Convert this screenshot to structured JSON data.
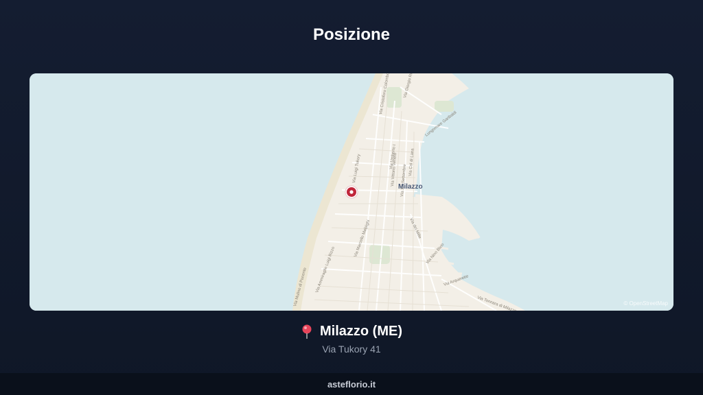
{
  "page": {
    "title": "Posizione"
  },
  "map": {
    "city_label": "Milazzo",
    "attribution": "© OpenStreetMap",
    "street_labels": [
      "Via Luigi Tukory",
      "Via Umberto I",
      "Via Marcello Malpighi",
      "Via dei Mille",
      "Via Nino Bixio",
      "Via Arquerette",
      "Via Tonnara di Milazzo",
      "Lungomare Garibaldi",
      "Via Ammiraglio Luigi Rizzo",
      "Via Mulino di Ponente",
      "Via Cristoforo Colombo",
      "Via Vittorio Veneto",
      "Via Col di Lana",
      "Via XX Settembre",
      "Via Giorgio Rizzo"
    ],
    "colors": {
      "sea": "#d6e9ed",
      "land": "#f3efe7",
      "beach": "#ece6d2",
      "park": "#dde7d3",
      "marker": "#c0263a"
    },
    "marker_icon": "location-marker-icon"
  },
  "location": {
    "pin_icon": "red-pushpin-icon",
    "title": "Milazzo (ME)",
    "address": "Via Tukory 41"
  },
  "footer": {
    "brand": "asteflorio.it"
  }
}
